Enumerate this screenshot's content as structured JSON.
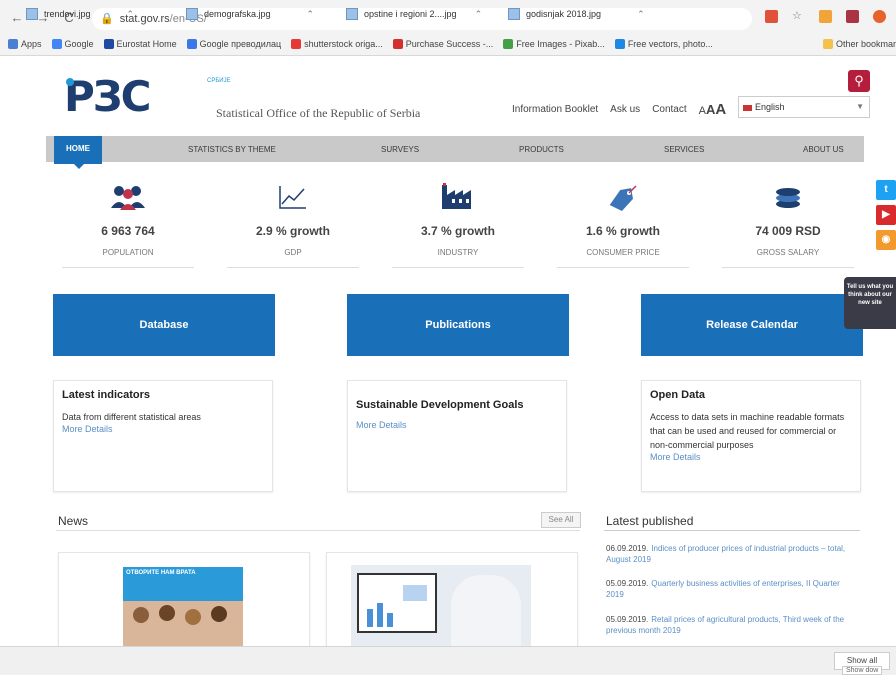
{
  "browser": {
    "url_host": "stat.gov.rs",
    "url_path": "/en-US/",
    "bookmarks": [
      {
        "label": "Apps",
        "color": "#4a7fd1"
      },
      {
        "label": "Google",
        "color": "#4285f4"
      },
      {
        "label": "Eurostat Home",
        "color": "#1e4ba1"
      },
      {
        "label": "Google преводилац",
        "color": "#3b78e7"
      },
      {
        "label": "shutterstock origa...",
        "color": "#e53935"
      },
      {
        "label": "Purchase Success -...",
        "color": "#d32f2f"
      },
      {
        "label": "Free Images - Pixab...",
        "color": "#43a047"
      },
      {
        "label": "Free vectors, photo...",
        "color": "#1e88e5"
      },
      {
        "label": "Other bookmar",
        "color": "#f2c14e"
      }
    ]
  },
  "header": {
    "logo_text": "РЗС",
    "logo_small": "СРБИЈЕ",
    "tagline": "Statistical Office of the Republic of Serbia",
    "links": [
      "Information Booklet",
      "Ask us",
      "Contact"
    ],
    "fontsize": "AAA",
    "language": "English"
  },
  "nav": {
    "home": "HOME",
    "items": [
      "STATISTICS BY THEME",
      "SURVEYS",
      "PRODUCTS",
      "SERVICES",
      "ABOUT US"
    ]
  },
  "stats": [
    {
      "value": "6 963 764",
      "label": "POPULATION",
      "icon": "people-icon"
    },
    {
      "value": "2.9 % growth",
      "label": "GDP",
      "icon": "chart-icon"
    },
    {
      "value": "3.7 % growth",
      "label": "INDUSTRY",
      "icon": "factory-icon"
    },
    {
      "value": "1.6 % growth",
      "label": "CONSUMER PRICE",
      "icon": "price-tag-icon"
    },
    {
      "value": "74 009 RSD",
      "label": "GROSS SALARY",
      "icon": "coins-icon"
    }
  ],
  "tiles": [
    "Database",
    "Publications",
    "Release Calendar"
  ],
  "boxes": [
    {
      "title": "Latest indicators",
      "text": "Data from different statistical areas",
      "more": "More Details"
    },
    {
      "title": "Sustainable Development Goals",
      "text": "",
      "more": "More Details"
    },
    {
      "title": "Open Data",
      "text": "Access to data sets in machine readable formats that can be used and reused for commercial or non-commercial purposes",
      "more": "More Details"
    }
  ],
  "news": {
    "title": "News",
    "see_all": "See All",
    "card1_text": "ОТВОРИТЕ НАМ ВРАТА"
  },
  "latest": {
    "title": "Latest published",
    "items": [
      {
        "date": "06.09.2019.",
        "text": "Indices of producer prices of industrial products – total, August 2019"
      },
      {
        "date": "05.09.2019.",
        "text": "Quarterly business activities of enterprises, II Quarter 2019"
      },
      {
        "date": "05.09.2019.",
        "text": "Retail prices of agricultural products, Third week of the previous month 2019"
      }
    ]
  },
  "social": {
    "tell_us": "Tell us what you think about our new site"
  },
  "downloads": {
    "files": [
      "trendovi.jpg",
      "demografska.jpg",
      "opstine i regioni 2....jpg",
      "godisnjak 2018.jpg"
    ],
    "show_all": "Show all",
    "show_all_tooltip": "Show dow"
  },
  "colors": {
    "brand_blue": "#1a70b8",
    "logo_navy": "#1d3e6e",
    "search_red": "#b41e3c",
    "link": "#5a8fc6"
  }
}
